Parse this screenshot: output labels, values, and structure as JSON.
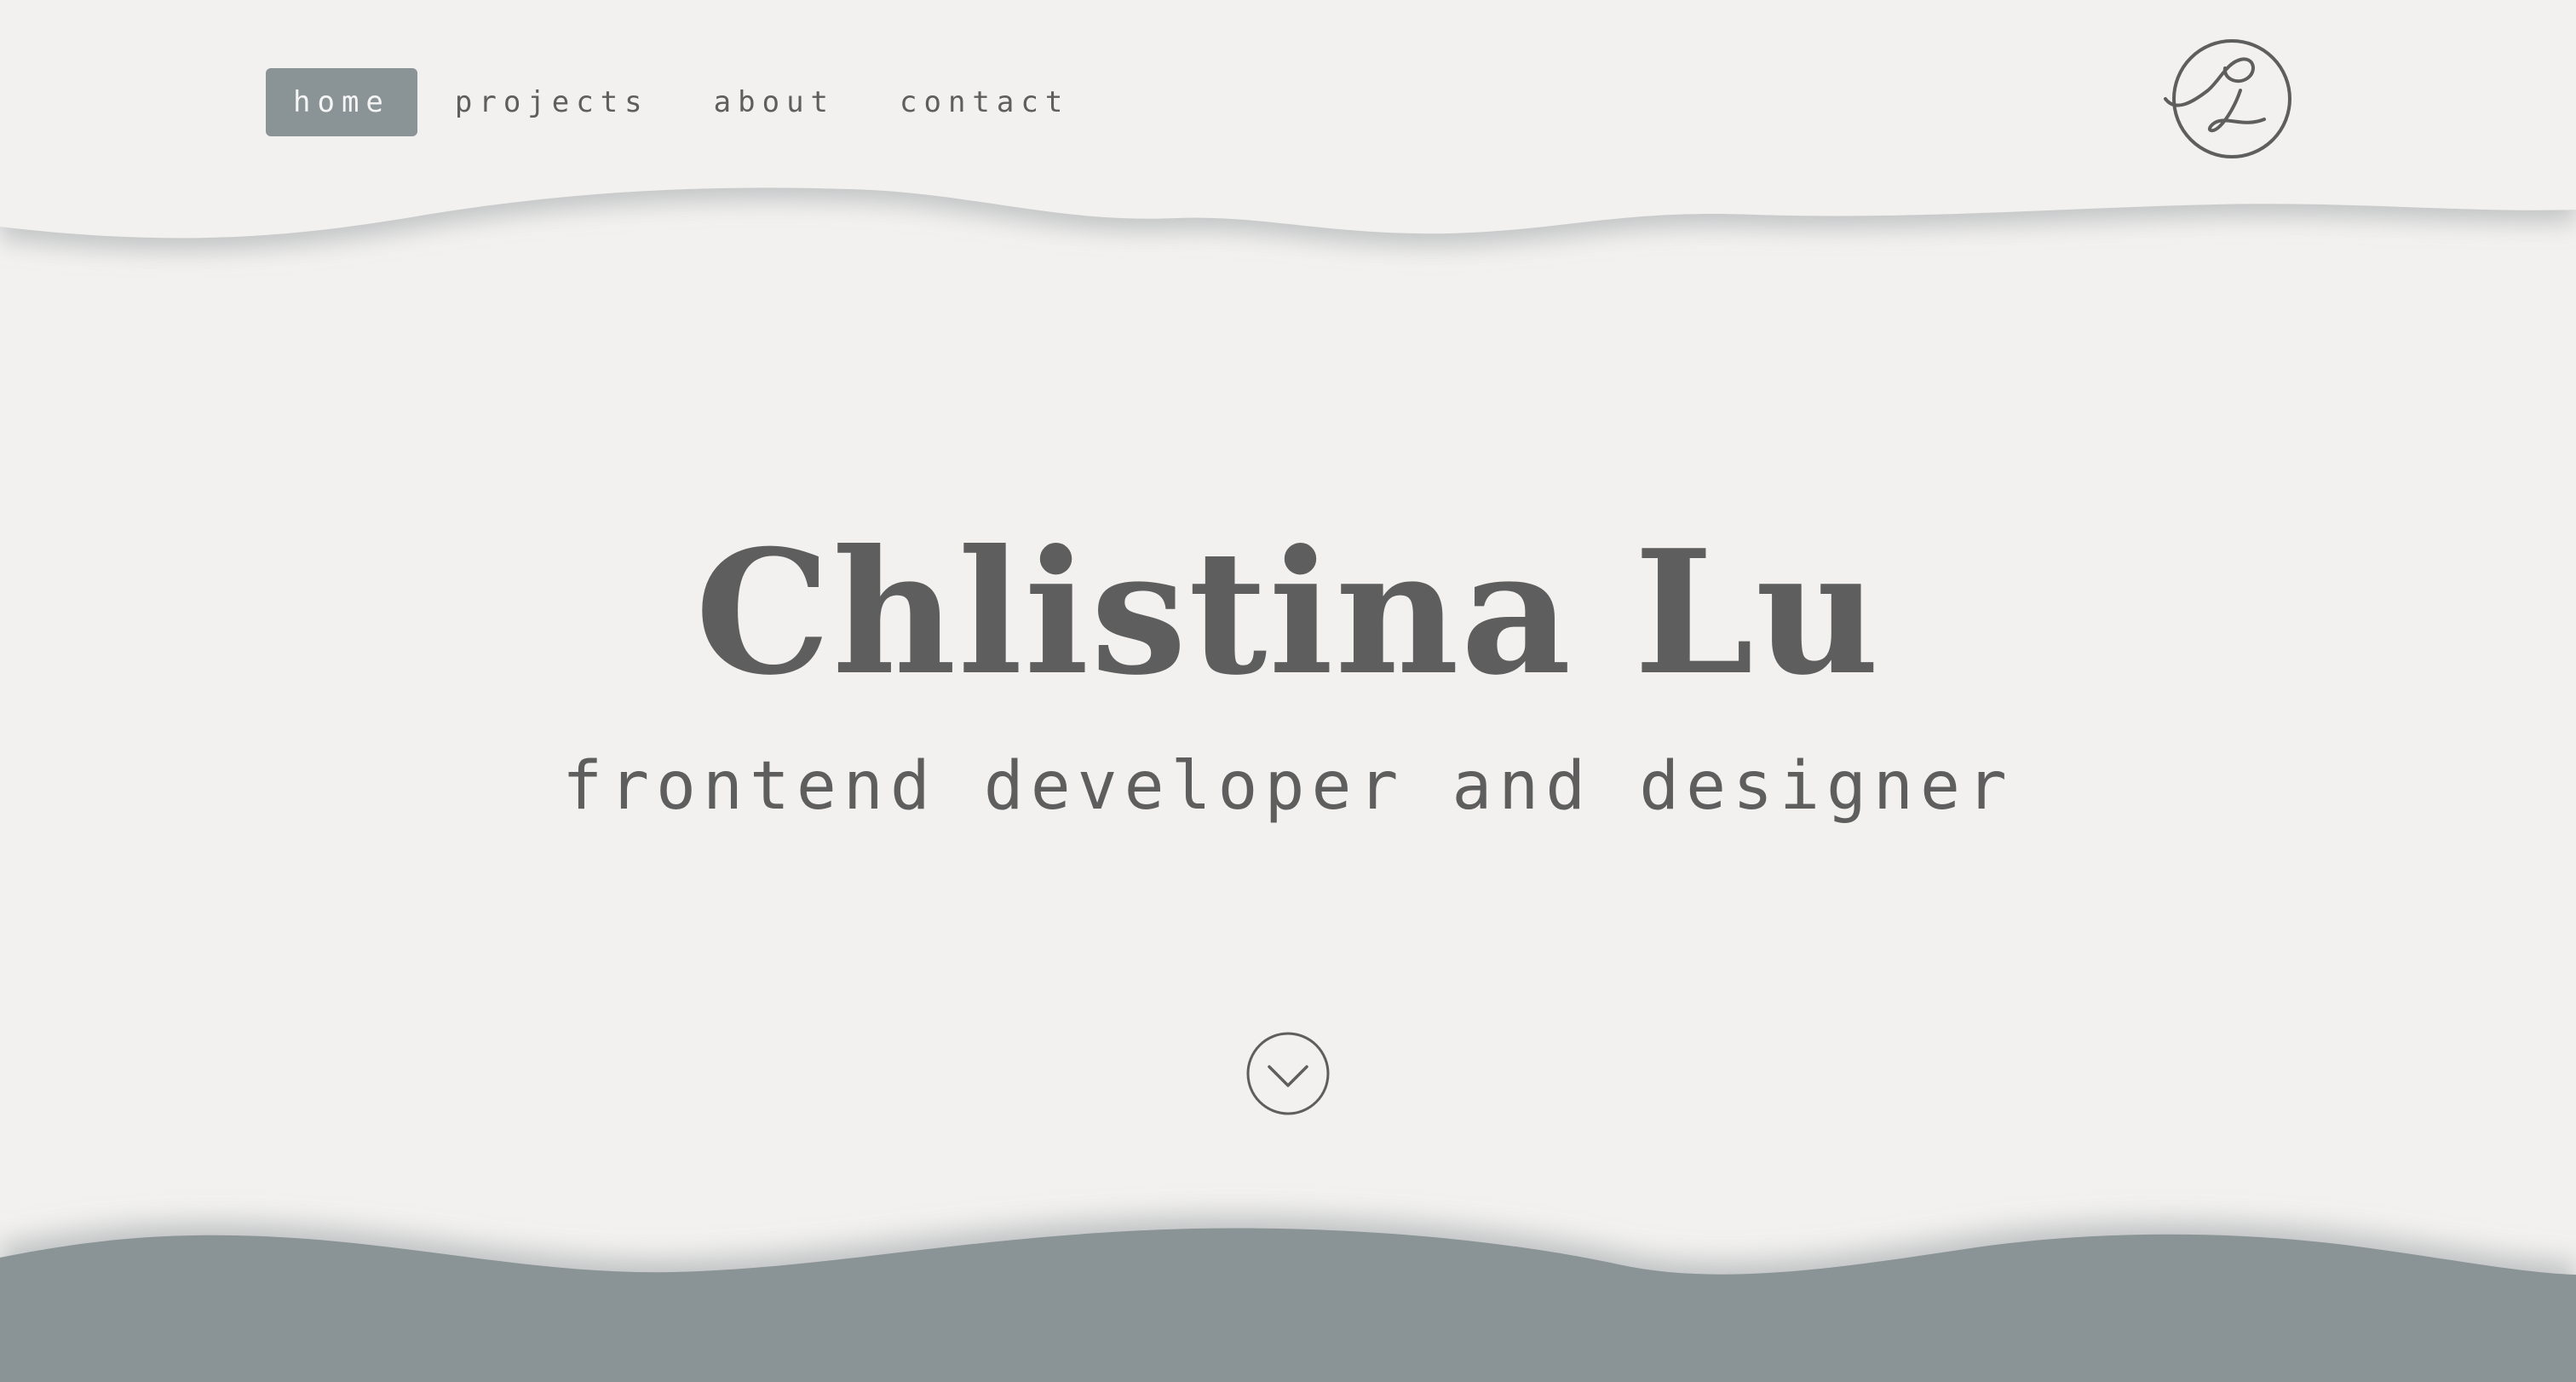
{
  "nav": {
    "items": [
      {
        "label": "home",
        "active": true
      },
      {
        "label": "projects",
        "active": false
      },
      {
        "label": "about",
        "active": false
      },
      {
        "label": "contact",
        "active": false
      }
    ]
  },
  "logo": {
    "icon": "cl-monogram-logo"
  },
  "hero": {
    "name": "Chlistina Lu",
    "subtitle": "frontend developer and designer"
  },
  "scroll": {
    "icon": "chevron-down-circle-icon"
  },
  "colors": {
    "background": "#f2f1ef",
    "accent": "#8a9396",
    "text": "#5e5e5e"
  }
}
